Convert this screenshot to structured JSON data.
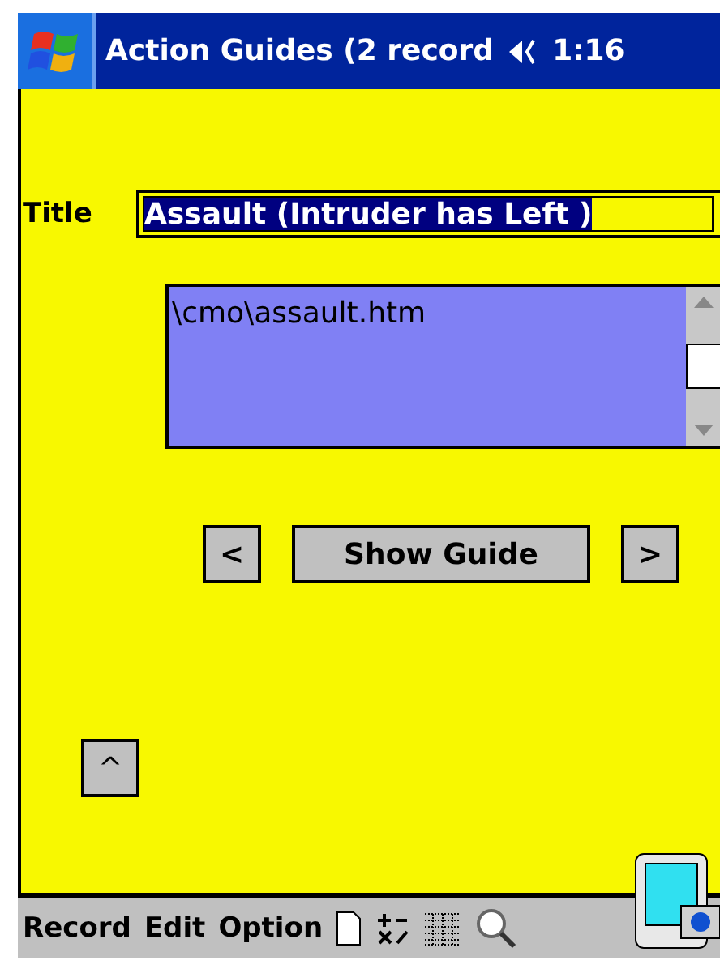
{
  "title_bar": {
    "title": "Action Guides (2 record",
    "time": "1:16"
  },
  "form": {
    "title_label": "Title",
    "title_value": "Assault (Intruder has Left )",
    "title_selected": true,
    "path": "\\cmo\\assault.htm"
  },
  "buttons": {
    "prev": "<",
    "show": "Show Guide",
    "next": ">",
    "up": "^"
  },
  "menu_bar": {
    "items": [
      "Record",
      "Edit",
      "Option"
    ]
  }
}
